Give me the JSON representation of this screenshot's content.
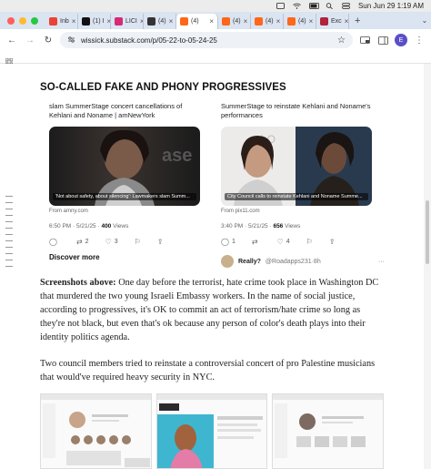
{
  "menubar": {
    "datetime": "Sun Jun 29  1:19 AM"
  },
  "window": {
    "traffic_colors": [
      "#ff5f57",
      "#febc2e",
      "#28c840"
    ]
  },
  "tabs": [
    {
      "label": "Inb",
      "icon": "gmail-icon",
      "color": "#ea4335"
    },
    {
      "label": "(1) I",
      "icon": "x-icon",
      "color": "#111111"
    },
    {
      "label": "LICI",
      "icon": "instagram-icon",
      "color": "#d62976"
    },
    {
      "label": "(4)",
      "icon": "slack-icon",
      "color": "#333333"
    },
    {
      "label": "(4)",
      "icon": "substack-icon",
      "color": "#ff6719",
      "active": true
    },
    {
      "label": "(4)",
      "icon": "substack-icon",
      "color": "#ff6719"
    },
    {
      "label": "(4)",
      "icon": "substack-icon",
      "color": "#ff6719"
    },
    {
      "label": "(4)",
      "icon": "substack-icon",
      "color": "#ff6719"
    },
    {
      "label": "Exc",
      "icon": "excel-icon",
      "color": "#b0243b"
    }
  ],
  "toolbar": {
    "url": "wissick.substack.com/p/05-22-to-05-24-25",
    "avatar_letter": "E",
    "avatar_color": "#5b4fc8"
  },
  "article": {
    "title": "SO-CALLED FAKE AND PHONY PROGRESSIVES",
    "card_left": {
      "heading": "slam SummerStage concert cancellations of Kehlani and Noname | amNewYork",
      "caption": "'Not about safety, about silencing': Lawmakers slam Summ...",
      "from": "From amny.com",
      "time": "6:50 PM · 5/21/25 · ",
      "views": "400",
      "views_label": " Views",
      "replies": "",
      "reposts": "2",
      "likes": "3",
      "discover": "Discover more"
    },
    "card_right": {
      "heading": "SummerStage to reinstate Kehlani and Noname's performances",
      "caption": "City Council calls to reinstate Kehlani and Noname Summe...",
      "from": "From pix11.com",
      "time": "3:40 PM · 5/21/25 · ",
      "views": "656",
      "views_label": " Views",
      "replies": "1",
      "reposts": "",
      "likes": "4",
      "reply_text": "Really?",
      "reply_handle": "@Roadapps231·8h"
    },
    "paragraph1_bold": "Screenshots above:",
    "paragraph1": " One day before the terrorist, hate crime took place in Washington DC that murdered the two young Israeli Embassy workers. In the name of social justice, according to progressives, it's OK to commit an act of terrorism/hate crime so long as they're not black, but even that's ok because any person of color's death plays into their identity politics agenda.",
    "paragraph2": "Two council members tried to reinstate a controversial concert of pro Palestine musicians that would've required heavy security in NYC."
  }
}
